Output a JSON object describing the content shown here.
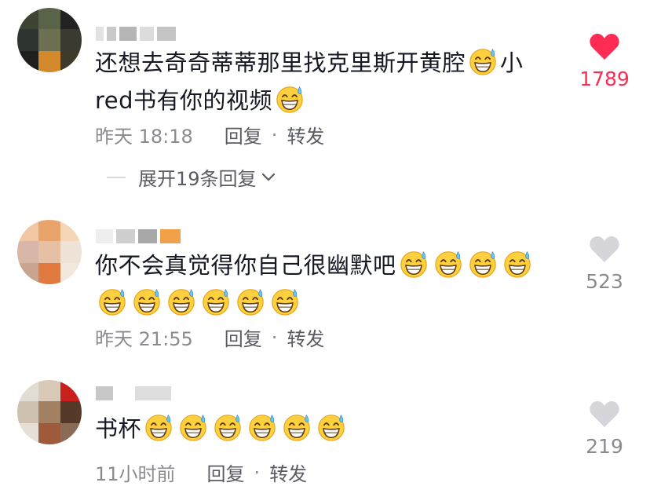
{
  "colors": {
    "like_active": "#fe2c55",
    "like_inactive": "#d6d6da",
    "meta": "#8a8b91"
  },
  "comments": [
    {
      "username_obscured": true,
      "text_lines": [
        "还想去奇奇蒂蒂那里找克里斯开黄腔",
        "小",
        "red书有你的视频"
      ],
      "time": "昨天 18:18",
      "reply_label": "回复",
      "share_label": "转发",
      "likes": "1789",
      "liked": true,
      "emoji": "grinning-sweat-emoji"
    },
    {
      "username_obscured": true,
      "text": "你不会真觉得你自己很幽默吧",
      "time": "昨天 21:55",
      "reply_label": "回复",
      "share_label": "转发",
      "likes": "523",
      "liked": false,
      "emoji": "grinning-sweat-emoji"
    },
    {
      "username_obscured": true,
      "text": "书杯",
      "time": "11小时前",
      "reply_label": "回复",
      "share_label": "转发",
      "likes": "219",
      "liked": false,
      "emoji": "grinning-sweat-emoji"
    }
  ],
  "expand_replies": {
    "label": "展开19条回复",
    "icon": "chevron-down-icon"
  },
  "meta_separator": "·"
}
